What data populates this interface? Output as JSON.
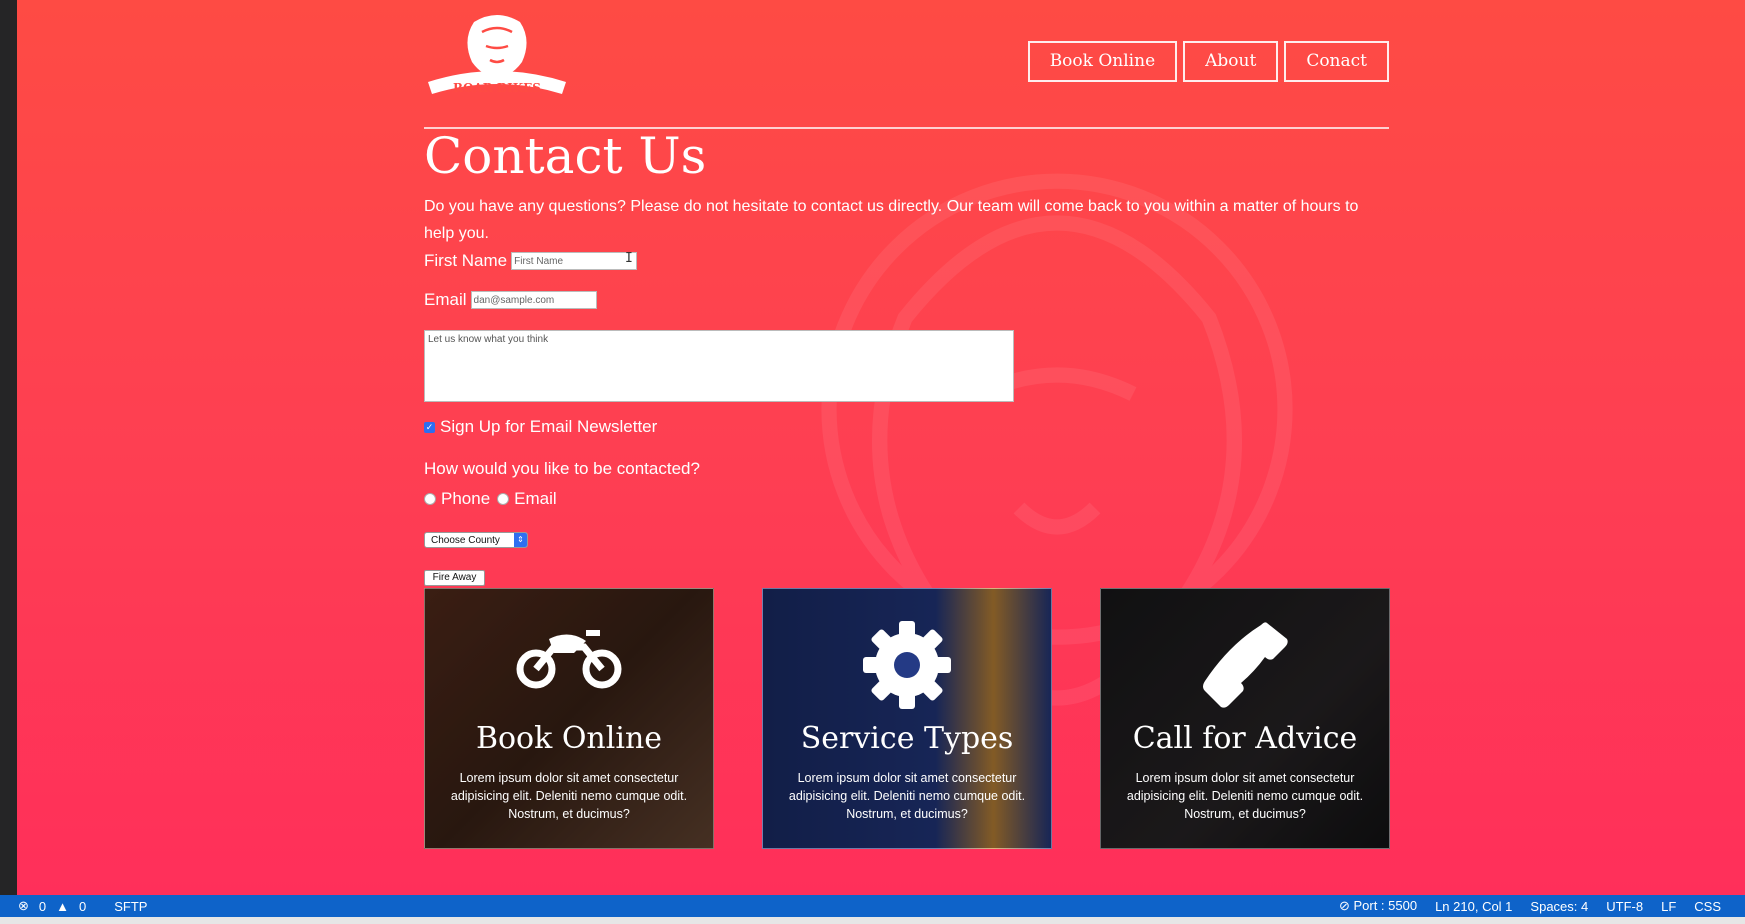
{
  "header": {
    "logo_text": "ROAR BIKES",
    "nav": [
      {
        "label": "Book Online"
      },
      {
        "label": "About"
      },
      {
        "label": "Conact"
      }
    ]
  },
  "main": {
    "title": "Contact Us",
    "intro": "Do you have any questions? Please do not hesitate to contact us directly. Our team will come back to you within a matter of hours to help you."
  },
  "form": {
    "first_name_label": "First Name",
    "first_name_placeholder": "First Name",
    "email_label": "Email",
    "email_placeholder": "dan@sample.com",
    "message_placeholder": "Let us know what you think",
    "newsletter_label": "Sign Up for Email Newsletter",
    "newsletter_checked": true,
    "contact_question": "How would you like to be contacted?",
    "contact_options": [
      {
        "label": "Phone"
      },
      {
        "label": "Email"
      }
    ],
    "county_selected": "Choose County",
    "submit_label": "Fire Away"
  },
  "cards": [
    {
      "title": "Book Online",
      "icon": "motorcycle-icon",
      "text": "Lorem ipsum dolor sit amet consectetur adipisicing elit. Deleniti nemo cumque odit. Nostrum, et ducimus?"
    },
    {
      "title": "Service Types",
      "icon": "gear-icon",
      "text": "Lorem ipsum dolor sit amet consectetur adipisicing elit. Deleniti nemo cumque odit. Nostrum, et ducimus?"
    },
    {
      "title": "Call for Advice",
      "icon": "phone-icon",
      "text": "Lorem ipsum dolor sit amet consectetur adipisicing elit. Deleniti nemo cumque odit. Nostrum, et ducimus?"
    }
  ],
  "statusbar": {
    "errors": "0",
    "warnings": "0",
    "sftp": "SFTP",
    "port": "Port : 5500",
    "position": "Ln 210, Col 1",
    "spaces": "Spaces: 4",
    "encoding": "UTF-8",
    "eol": "LF",
    "language": "CSS"
  },
  "colors": {
    "page_gradient_top": "#fe4b44",
    "page_gradient_bottom": "#ff2f5a",
    "statusbar": "#0e63c9"
  }
}
